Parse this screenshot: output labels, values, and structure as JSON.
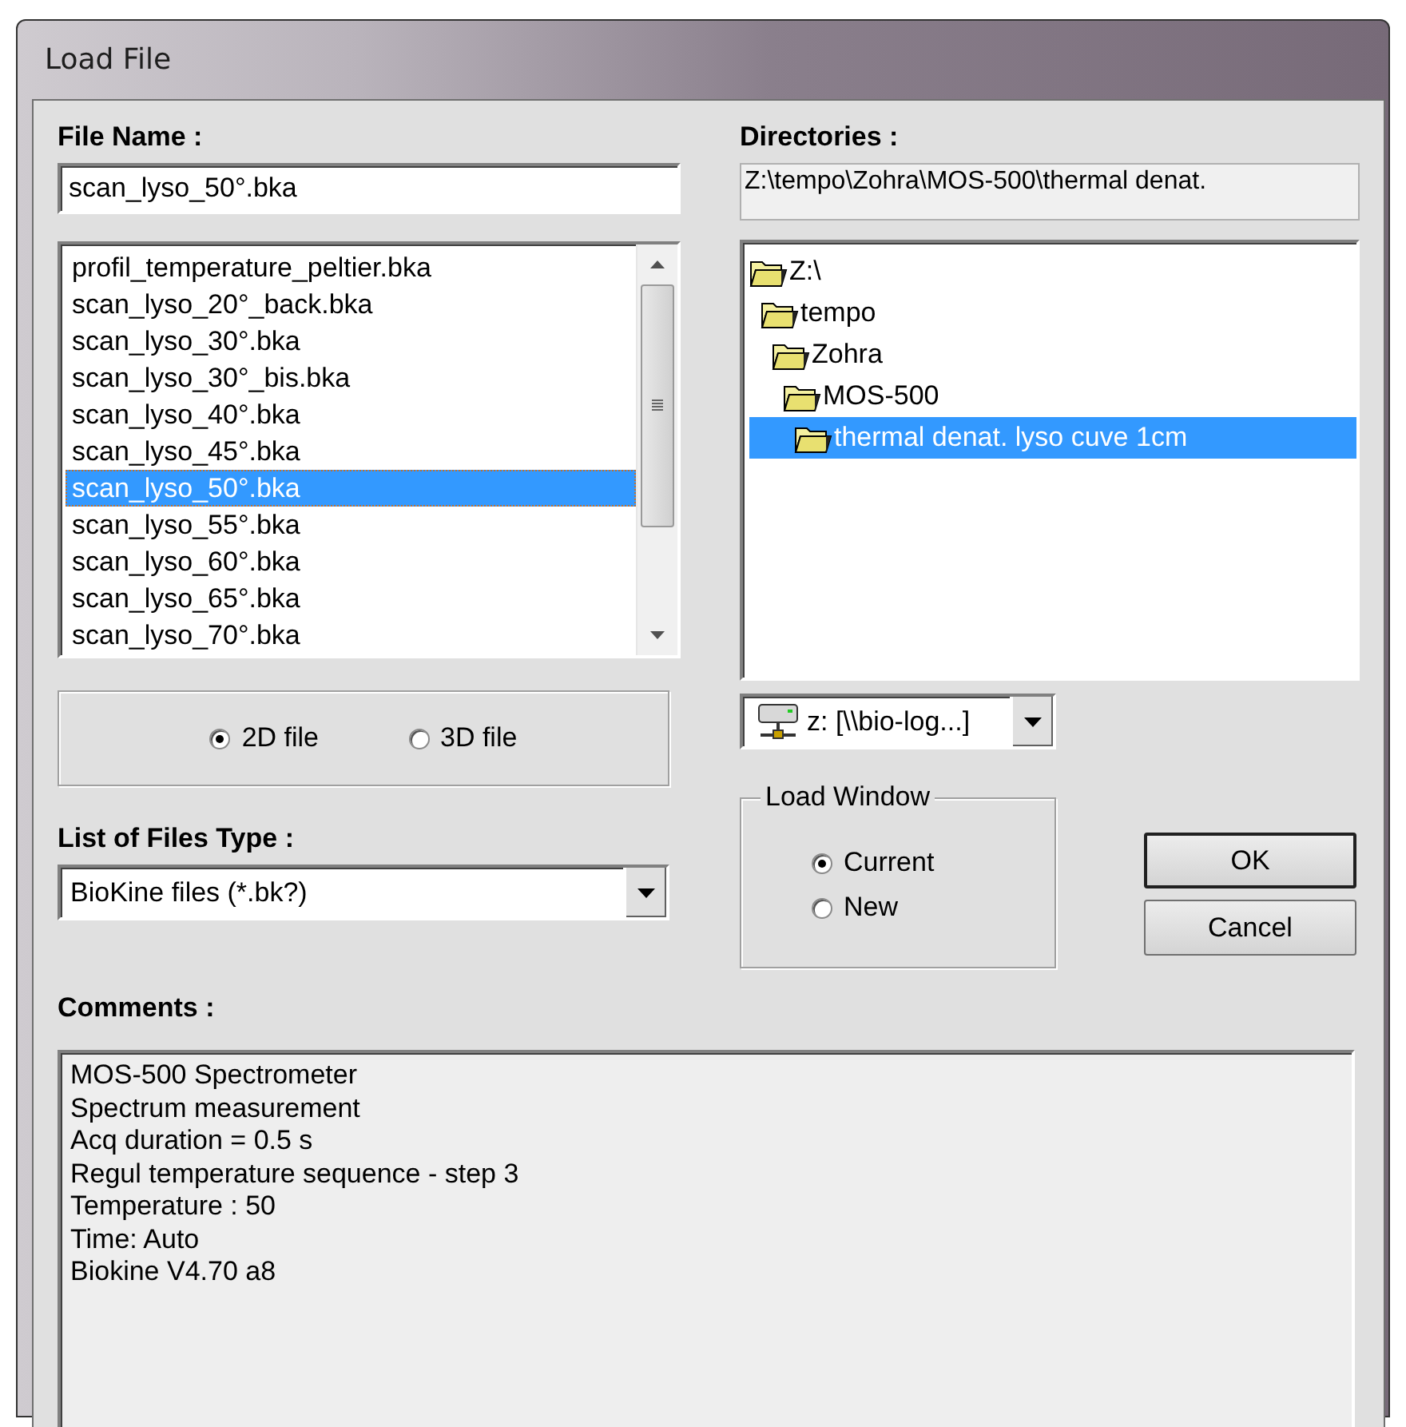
{
  "window": {
    "title": "Load File"
  },
  "file_name": {
    "label": "File Name :",
    "value": "scan_lyso_50°.bka"
  },
  "files": [
    {
      "name": "profil_temperature_peltier.bka",
      "selected": false
    },
    {
      "name": "scan_lyso_20°_back.bka",
      "selected": false
    },
    {
      "name": "scan_lyso_30°.bka",
      "selected": false
    },
    {
      "name": "scan_lyso_30°_bis.bka",
      "selected": false
    },
    {
      "name": "scan_lyso_40°.bka",
      "selected": false
    },
    {
      "name": "scan_lyso_45°.bka",
      "selected": false
    },
    {
      "name": "scan_lyso_50°.bka",
      "selected": true
    },
    {
      "name": "scan_lyso_55°.bka",
      "selected": false
    },
    {
      "name": "scan_lyso_60°.bka",
      "selected": false
    },
    {
      "name": "scan_lyso_65°.bka",
      "selected": false
    },
    {
      "name": "scan_lyso_70°.bka",
      "selected": false
    }
  ],
  "file_dimension": [
    {
      "label": "2D file",
      "selected": true
    },
    {
      "label": "3D file",
      "selected": false
    }
  ],
  "files_type": {
    "label": "List of Files Type :",
    "value": "BioKine files (*.bk?)"
  },
  "directories": {
    "label": "Directories :",
    "path": "Z:\\tempo\\Zohra\\MOS-500\\thermal denat.",
    "tree": [
      {
        "name": "Z:\\",
        "selected": false,
        "children": [
          {
            "name": "tempo",
            "selected": false,
            "children": [
              {
                "name": "Zohra",
                "selected": false,
                "children": [
                  {
                    "name": "MOS-500",
                    "selected": false,
                    "children": [
                      {
                        "name": "thermal denat. lyso cuve 1cm",
                        "selected": true
                      }
                    ]
                  }
                ]
              }
            ]
          }
        ]
      }
    ]
  },
  "drive": {
    "value": "z: [\\\\bio-log...]"
  },
  "load_window": {
    "title": "Load Window",
    "options": [
      {
        "label": "Current",
        "selected": true
      },
      {
        "label": "New",
        "selected": false
      }
    ]
  },
  "buttons": [
    {
      "label": "OK",
      "default": true
    },
    {
      "label": "Cancel",
      "default": false
    }
  ],
  "comments": {
    "label": "Comments :",
    "lines": [
      "MOS-500 Spectrometer",
      "Spectrum measurement",
      "Acq duration = 0.5 s",
      "Regul temperature sequence - step 3",
      "Temperature : 50",
      "Time: Auto",
      "Biokine V4.70 a8"
    ]
  }
}
